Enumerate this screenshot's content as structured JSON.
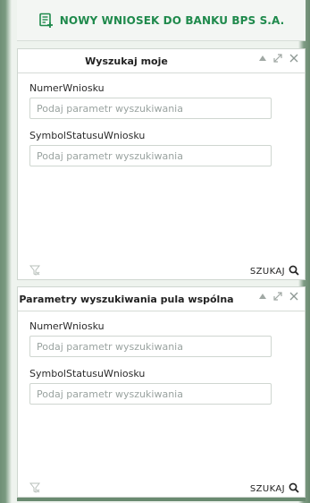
{
  "header": {
    "new_application_label": "NOWY WNIOSEK DO BANKU BPS S.A.",
    "icon": "document-plus-icon",
    "accent_color": "#1f8a4c"
  },
  "panels": [
    {
      "title": "Wyszukaj moje",
      "fields": [
        {
          "label": "NumerWniosku",
          "placeholder": "Podaj parametr wyszukiwania",
          "value": ""
        },
        {
          "label": "SymbolStatusuWniosku",
          "placeholder": "Podaj parametr wyszukiwania",
          "value": ""
        }
      ],
      "search_label": "SZUKAJ"
    },
    {
      "title": "Parametry wyszukiwania pula wspólna",
      "fields": [
        {
          "label": "NumerWniosku",
          "placeholder": "Podaj parametr wyszukiwania",
          "value": ""
        },
        {
          "label": "SymbolStatusuWniosku",
          "placeholder": "Podaj parametr wyszukiwania",
          "value": ""
        }
      ],
      "search_label": "SZUKAJ"
    }
  ]
}
